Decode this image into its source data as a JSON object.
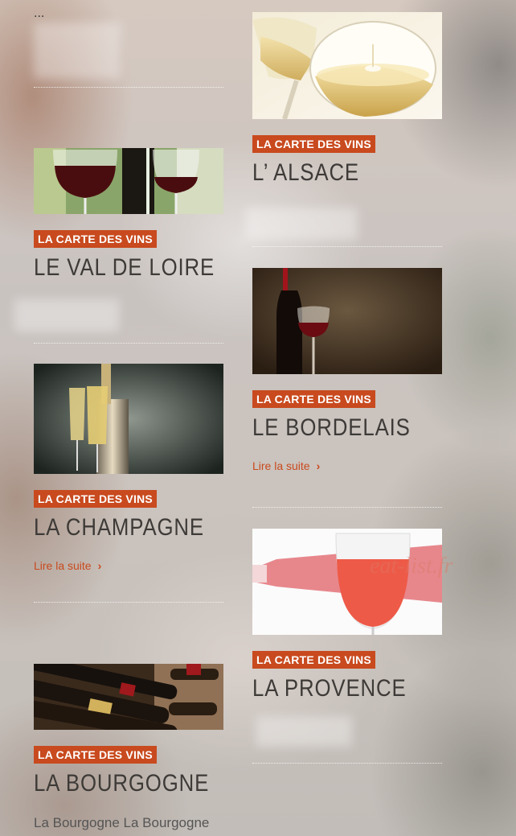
{
  "ellipsis": "...",
  "watermark": "eat-list.fr",
  "cards": [
    {
      "badge": "LA CARTE DES VINS",
      "title": "L’ ALSACE",
      "image": "white-wine-glasses"
    },
    {
      "badge": "LA CARTE DES VINS",
      "title": "LE VAL DE LOIRE",
      "image": "red-wine-glasses"
    },
    {
      "badge": "LA CARTE DES VINS",
      "title": "LE BORDELAIS",
      "image": "red-wine-bottle-glass",
      "read_more": "Lire la suite",
      "chevron": "›"
    },
    {
      "badge": "LA CARTE DES VINS",
      "title": "LA CHAMPAGNE",
      "image": "champagne-flutes-bucket",
      "read_more": "Lire la suite",
      "chevron": "›"
    },
    {
      "badge": "LA CARTE DES VINS",
      "title": "LA PROVENCE",
      "image": "rose-wine-glass"
    },
    {
      "badge": "LA CARTE DES VINS",
      "title": "LA BOURGOGNE",
      "image": "wine-bottles-rack",
      "excerpt": "La Bourgogne La Bourgogne"
    }
  ]
}
